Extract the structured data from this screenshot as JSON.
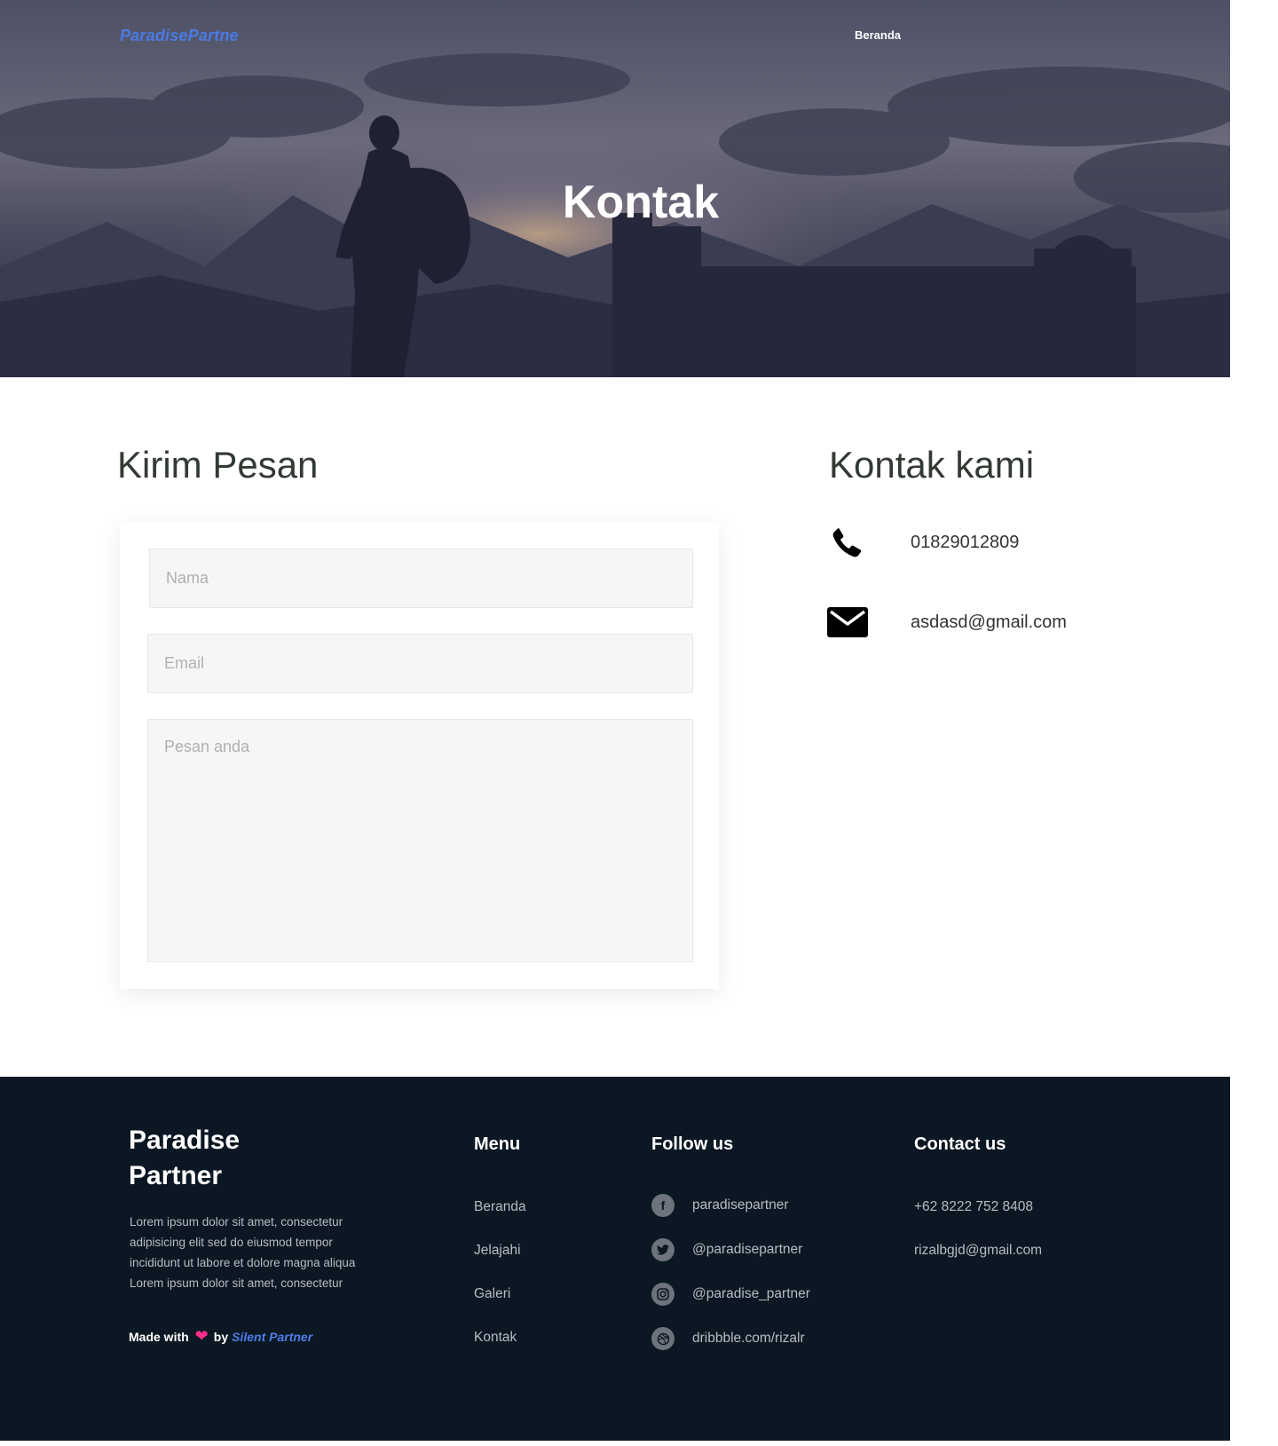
{
  "header": {
    "brand": "ParadisePartne",
    "nav": [
      "Beranda"
    ],
    "hero_title": "Kontak"
  },
  "form": {
    "heading": "Kirim Pesan",
    "name_placeholder": "Nama",
    "email_placeholder": "Email",
    "message_placeholder": "Pesan anda"
  },
  "contact": {
    "heading": "Kontak kami",
    "phone": "01829012809",
    "email": "asdasd@gmail.com",
    "phone_icon": "phone-icon",
    "email_icon": "mail-icon"
  },
  "footer": {
    "brand": "Paradise Partner",
    "description": "Lorem ipsum dolor sit amet, consectetur adipisicing elit sed do eiusmod tempor incididunt ut labore et dolore magna aliqua Lorem ipsum dolor sit amet, consectetur",
    "made_with": "Made with",
    "by": "by",
    "author": "Silent Partner",
    "menu_title": "Menu",
    "menu": [
      "Beranda",
      "Jelajahi",
      "Galeri",
      "Kontak"
    ],
    "follow_title": "Follow us",
    "social": [
      {
        "icon": "facebook-icon",
        "text": "paradisepartner"
      },
      {
        "icon": "twitter-icon",
        "text": "@paradisepartner"
      },
      {
        "icon": "instagram-icon",
        "text": "@paradise_partner"
      },
      {
        "icon": "dribbble-icon",
        "text": "dribbble.com/rizalr"
      }
    ],
    "contact_title": "Contact us",
    "contact_phone": "+62 8222 752 8408",
    "contact_email": "rizalbgjd@gmail.com"
  },
  "colors": {
    "brand_blue": "#4a7be6",
    "footer_bg": "#0b1723",
    "heart": "#ff2e8e"
  }
}
